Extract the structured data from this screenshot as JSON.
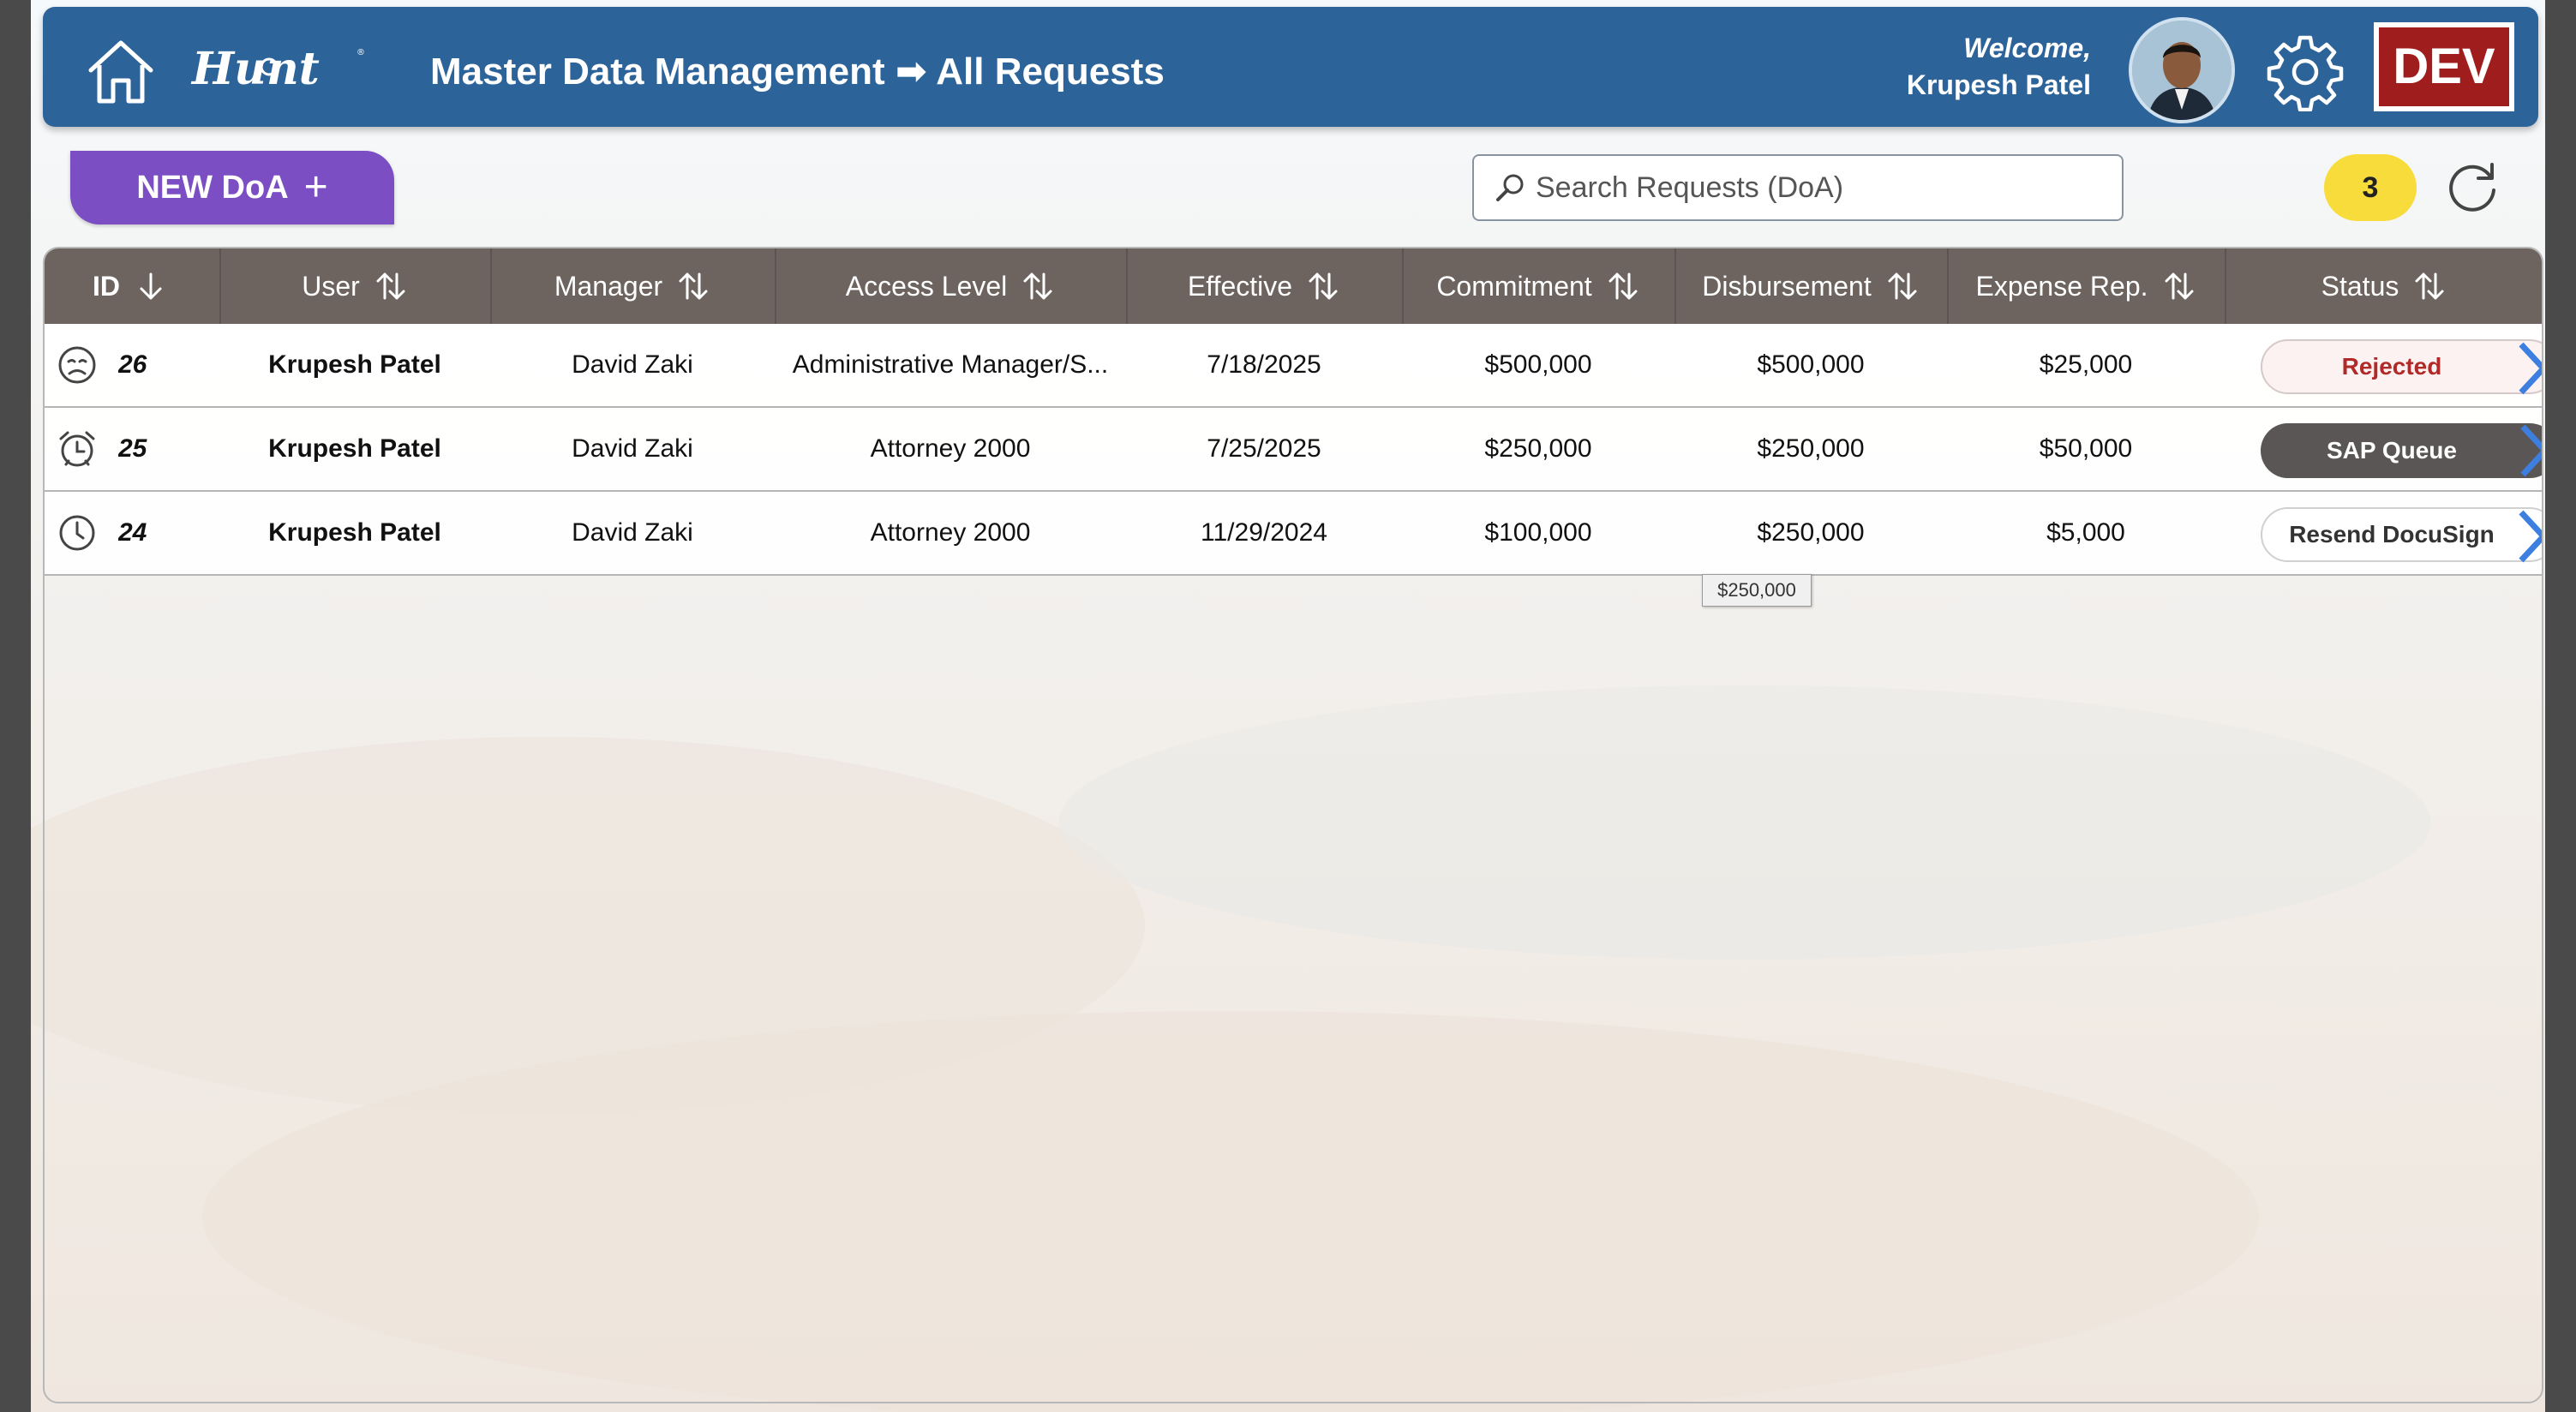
{
  "header": {
    "title": "Master Data Management ➡ All Requests",
    "welcome_label": "Welcome,",
    "user_name": "Krupesh Patel",
    "env_badge": "DEV",
    "color": "#2c6399"
  },
  "toolbar": {
    "new_button_label": "NEW DoA",
    "search_placeholder": "Search Requests (DoA)",
    "request_count": "3"
  },
  "table": {
    "columns": [
      "ID",
      "User",
      "Manager",
      "Access Level",
      "Effective",
      "Commitment",
      "Disbursement",
      "Expense Rep.",
      "Status"
    ],
    "rows": [
      {
        "status_icon": "sad-face-icon",
        "id": "26",
        "user": "Krupesh Patel",
        "manager": "David Zaki",
        "access_level": "Administrative Manager/S...",
        "effective": "7/18/2025",
        "commitment": "$500,000",
        "disbursement": "$500,000",
        "expense": "$25,000",
        "status": "Rejected"
      },
      {
        "status_icon": "alarm-clock-icon",
        "id": "25",
        "user": "Krupesh Patel",
        "manager": "David Zaki",
        "access_level": "Attorney 2000",
        "effective": "7/25/2025",
        "commitment": "$250,000",
        "disbursement": "$250,000",
        "expense": "$50,000",
        "status": "SAP Queue"
      },
      {
        "status_icon": "clock-icon",
        "id": "24",
        "user": "Krupesh Patel",
        "manager": "David Zaki",
        "access_level": "Attorney 2000",
        "effective": "11/29/2024",
        "commitment": "$100,000",
        "disbursement": "$250,000",
        "expense": "$5,000",
        "status": "Resend DocuSign"
      }
    ]
  },
  "tooltip": "$250,000"
}
